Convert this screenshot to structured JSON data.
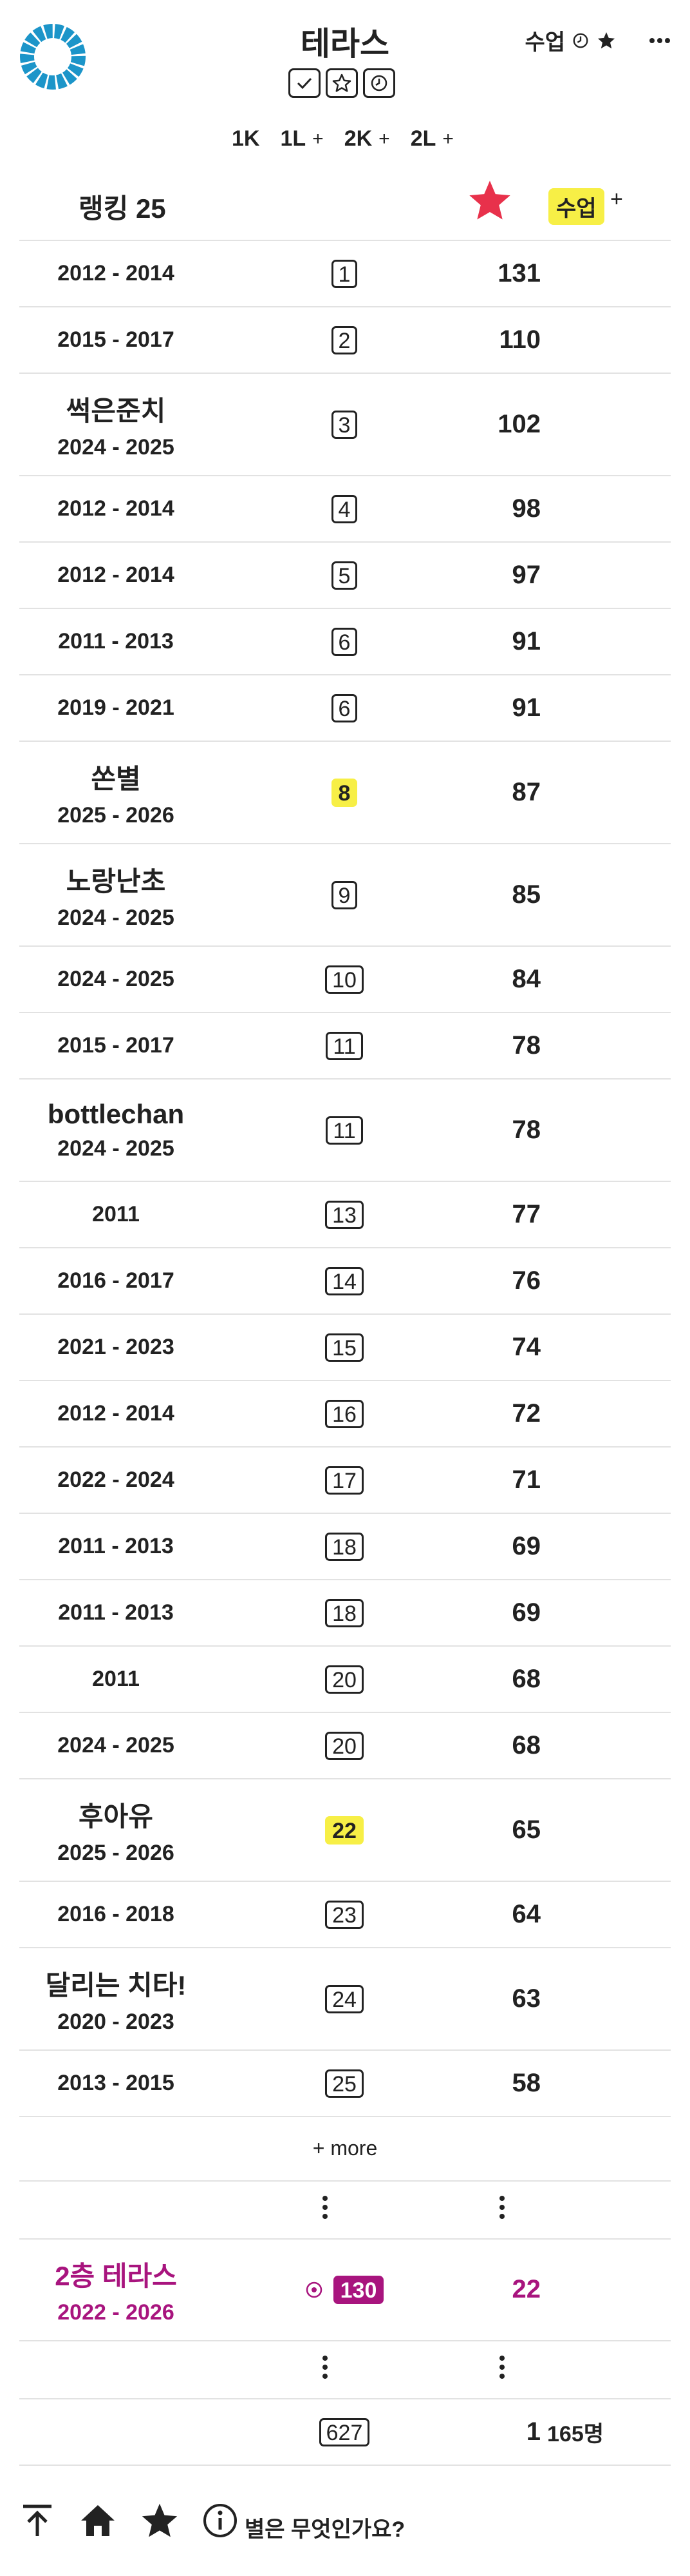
{
  "header": {
    "title": "테라스",
    "top_right": {
      "lesson_label": "수업",
      "icons": [
        "clock-icon",
        "star-icon",
        "more-icon"
      ]
    },
    "title_icons": [
      "check-icon",
      "star-outline-icon",
      "clock-icon"
    ]
  },
  "filters": [
    {
      "label": "1K",
      "plus": ""
    },
    {
      "label": "1L",
      "plus": "+"
    },
    {
      "label": "2K",
      "plus": "+"
    },
    {
      "label": "2L",
      "plus": "+"
    }
  ],
  "ranking": {
    "title": "랭킹 25",
    "lesson_badge": "수업",
    "lesson_plus": "+",
    "accent_color": "#e8314b",
    "highlight_color": "#f7ef46",
    "rows": [
      {
        "name": "",
        "years": "2012 - 2014",
        "rank": "1",
        "count": "131",
        "highlight": false
      },
      {
        "name": "",
        "years": "2015 - 2017",
        "rank": "2",
        "count": "110",
        "highlight": false
      },
      {
        "name": "썩은준치",
        "years": "2024 - 2025",
        "rank": "3",
        "count": "102",
        "highlight": false
      },
      {
        "name": "",
        "years": "2012 - 2014",
        "rank": "4",
        "count": "98",
        "highlight": false
      },
      {
        "name": "",
        "years": "2012 - 2014",
        "rank": "5",
        "count": "97",
        "highlight": false
      },
      {
        "name": "",
        "years": "2011 - 2013",
        "rank": "6",
        "count": "91",
        "highlight": false
      },
      {
        "name": "",
        "years": "2019 - 2021",
        "rank": "6",
        "count": "91",
        "highlight": false
      },
      {
        "name": "쏜별",
        "years": "2025 - 2026",
        "rank": "8",
        "count": "87",
        "highlight": true
      },
      {
        "name": "노랑난초",
        "years": "2024 - 2025",
        "rank": "9",
        "count": "85",
        "highlight": false
      },
      {
        "name": "",
        "years": "2024 - 2025",
        "rank": "10",
        "count": "84",
        "highlight": false
      },
      {
        "name": "",
        "years": "2015 - 2017",
        "rank": "11",
        "count": "78",
        "highlight": false
      },
      {
        "name": "bottlechan",
        "years": "2024 - 2025",
        "rank": "11",
        "count": "78",
        "highlight": false
      },
      {
        "name": "",
        "years": "2011",
        "rank": "13",
        "count": "77",
        "highlight": false
      },
      {
        "name": "",
        "years": "2016 - 2017",
        "rank": "14",
        "count": "76",
        "highlight": false
      },
      {
        "name": "",
        "years": "2021 - 2023",
        "rank": "15",
        "count": "74",
        "highlight": false
      },
      {
        "name": "",
        "years": "2012 - 2014",
        "rank": "16",
        "count": "72",
        "highlight": false
      },
      {
        "name": "",
        "years": "2022 - 2024",
        "rank": "17",
        "count": "71",
        "highlight": false
      },
      {
        "name": "",
        "years": "2011 - 2013",
        "rank": "18",
        "count": "69",
        "highlight": false
      },
      {
        "name": "",
        "years": "2011 - 2013",
        "rank": "18",
        "count": "69",
        "highlight": false
      },
      {
        "name": "",
        "years": "2011",
        "rank": "20",
        "count": "68",
        "highlight": false
      },
      {
        "name": "",
        "years": "2024 - 2025",
        "rank": "20",
        "count": "68",
        "highlight": false
      },
      {
        "name": "후아유",
        "years": "2025 - 2026",
        "rank": "22",
        "count": "65",
        "highlight": true
      },
      {
        "name": "",
        "years": "2016 - 2018",
        "rank": "23",
        "count": "64",
        "highlight": false
      },
      {
        "name": "달리는 치타!",
        "years": "2020 - 2023",
        "rank": "24",
        "count": "63",
        "highlight": false
      },
      {
        "name": "",
        "years": "2013 - 2015",
        "rank": "25",
        "count": "58",
        "highlight": false
      }
    ],
    "more_label": "+ more"
  },
  "my_entry": {
    "name": "2층 테라스",
    "years": "2022 - 2026",
    "rank": "130",
    "count": "22",
    "color": "#a8147e"
  },
  "total": {
    "rank": "627",
    "count": "1",
    "members": "165명"
  },
  "footer": {
    "help_text": "별은 무엇인가요?",
    "icons": [
      "scroll-top-icon",
      "home-icon",
      "star-icon",
      "info-icon"
    ]
  }
}
